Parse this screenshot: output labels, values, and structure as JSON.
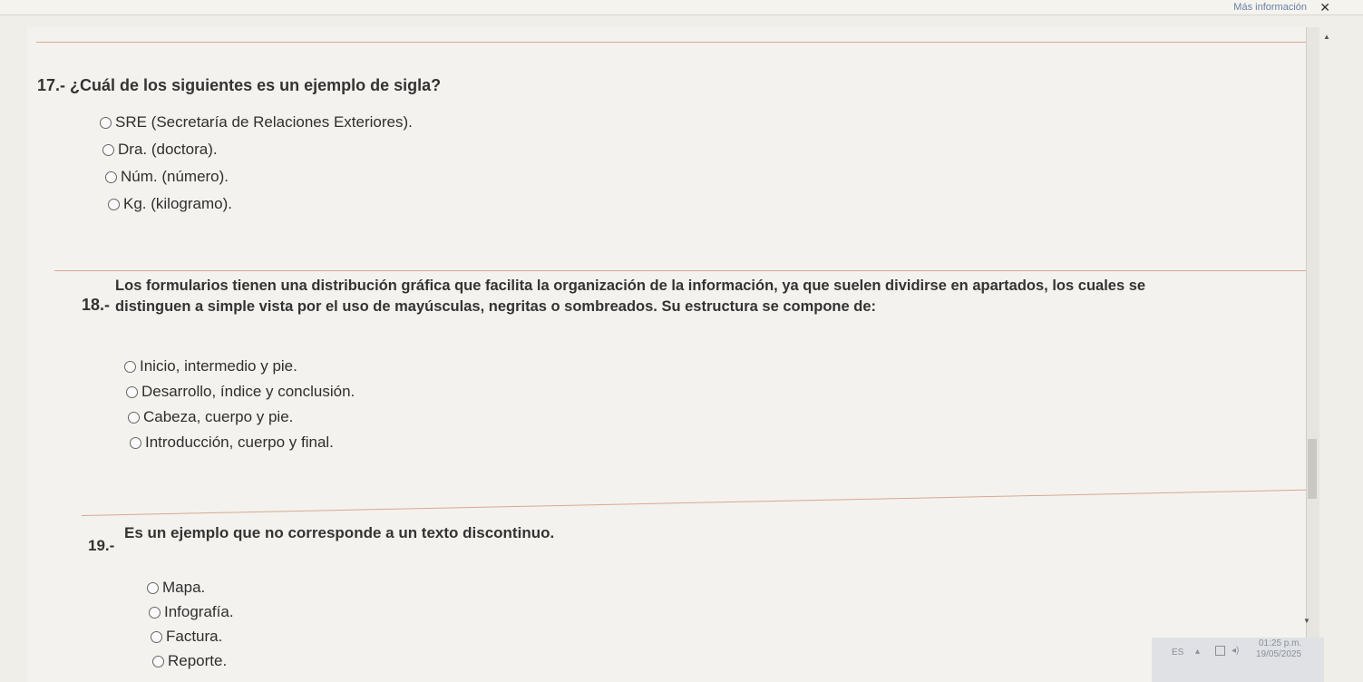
{
  "browser": {
    "more_info": "Más información",
    "close_glyph": "✕"
  },
  "questions": [
    {
      "number": "17.-",
      "text": "¿Cuál de los siguientes es un ejemplo de sigla?",
      "options": [
        "SRE (Secretaría de Relaciones Exteriores).",
        "Dra. (doctora).",
        "Núm. (número).",
        "Kg. (kilogramo)."
      ]
    },
    {
      "number": "18.-",
      "text_line1": "Los formularios tienen una distribución gráfica que facilita la organización de la información, ya que suelen dividirse en apartados, los cuales se",
      "text_line2": "distinguen a simple vista por el uso de mayúsculas, negritas o sombreados. Su estructura se compone de:",
      "options": [
        "Inicio, intermedio y pie.",
        "Desarrollo, índice y conclusión.",
        "Cabeza, cuerpo y pie.",
        "Introducción, cuerpo y final."
      ]
    },
    {
      "number": "19.-",
      "text": "Es un ejemplo que no corresponde a un texto discontinuo.",
      "options": [
        "Mapa.",
        "Infografía.",
        "Factura.",
        "Reporte."
      ]
    }
  ],
  "taskbar": {
    "language": "ES",
    "time": "01:25 p.m.",
    "date": "19/05/2025"
  }
}
